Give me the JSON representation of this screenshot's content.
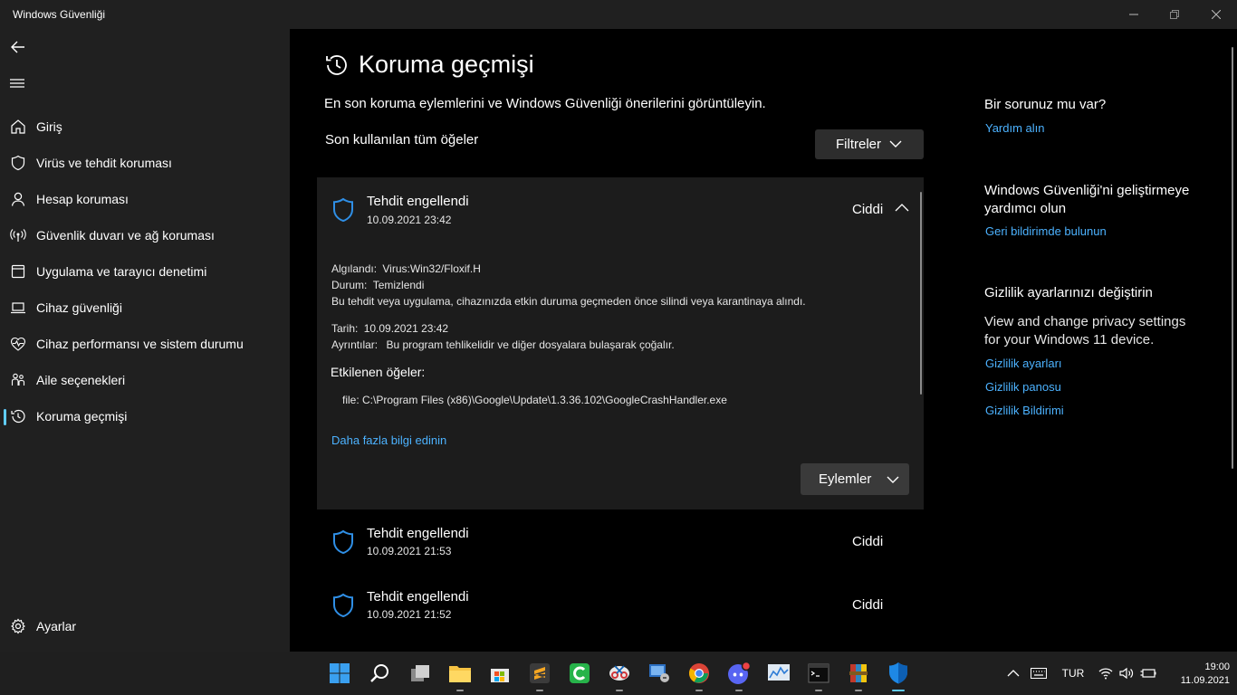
{
  "window": {
    "title": "Windows Güvenliği"
  },
  "sidebar": {
    "items": [
      {
        "label": "Giriş",
        "icon": "home-icon"
      },
      {
        "label": "Virüs ve tehdit koruması",
        "icon": "shield-icon"
      },
      {
        "label": "Hesap koruması",
        "icon": "person-icon"
      },
      {
        "label": "Güvenlik duvarı ve ağ koruması",
        "icon": "antenna-icon"
      },
      {
        "label": "Uygulama ve tarayıcı denetimi",
        "icon": "app-window-icon"
      },
      {
        "label": "Cihaz güvenliği",
        "icon": "laptop-icon"
      },
      {
        "label": "Cihaz performansı ve sistem durumu",
        "icon": "heart-pulse-icon"
      },
      {
        "label": "Aile seçenekleri",
        "icon": "family-icon"
      },
      {
        "label": "Koruma geçmişi",
        "icon": "history-icon"
      }
    ],
    "settings_label": "Ayarlar"
  },
  "main": {
    "title": "Koruma geçmişi",
    "subtitle": "En son koruma eylemlerini ve Windows Güvenliği önerilerini görüntüleyin.",
    "section_title": "Son kullanılan tüm öğeler",
    "filter_label": "Filtreler",
    "expanded": {
      "title": "Tehdit engellendi",
      "date": "10.09.2021 23:42",
      "severity": "Ciddi",
      "detected_label": "Algılandı:",
      "detected_value": "Virus:Win32/Floxif.H",
      "status_label": "Durum:",
      "status_value": "Temizlendi",
      "description": "Bu tehdit veya uygulama, cihazınızda etkin duruma geçmeden önce silindi veya karantinaya alındı.",
      "date_label": "Tarih:",
      "date_value": "10.09.2021 23:42",
      "details_label": "Ayrıntılar:",
      "details_value": "Bu program tehlikelidir ve diğer dosyalara bulaşarak çoğalır.",
      "affected_title": "Etkilenen öğeler:",
      "affected_file": "file: C:\\Program Files (x86)\\Google\\Update\\1.3.36.102\\GoogleCrashHandler.exe",
      "learn_more": "Daha fazla bilgi edinin",
      "actions_label": "Eylemler"
    },
    "rows": [
      {
        "title": "Tehdit engellendi",
        "date": "10.09.2021 21:53",
        "severity": "Ciddi"
      },
      {
        "title": "Tehdit engellendi",
        "date": "10.09.2021 21:52",
        "severity": "Ciddi"
      }
    ]
  },
  "right_panel": {
    "question_title": "Bir sorunuz mu var?",
    "help_link": "Yardım alın",
    "improve_title": "Windows Güvenliği'ni geliştirmeye yardımcı olun",
    "feedback_link": "Geri bildirimde bulunun",
    "privacy_title": "Gizlilik ayarlarınızı değiştirin",
    "privacy_text": "View and change privacy settings for your Windows 11 device.",
    "privacy_links": [
      "Gizlilik ayarları",
      "Gizlilik panosu",
      "Gizlilik Bildirimi"
    ]
  },
  "taskbar": {
    "language": "TUR",
    "time": "19:00",
    "date": "11.09.2021"
  },
  "colors": {
    "accent": "#4cb2ff",
    "shield": "#2f8fe6",
    "sidebar_bg": "#202020",
    "card_bg": "#1c1c1c"
  }
}
